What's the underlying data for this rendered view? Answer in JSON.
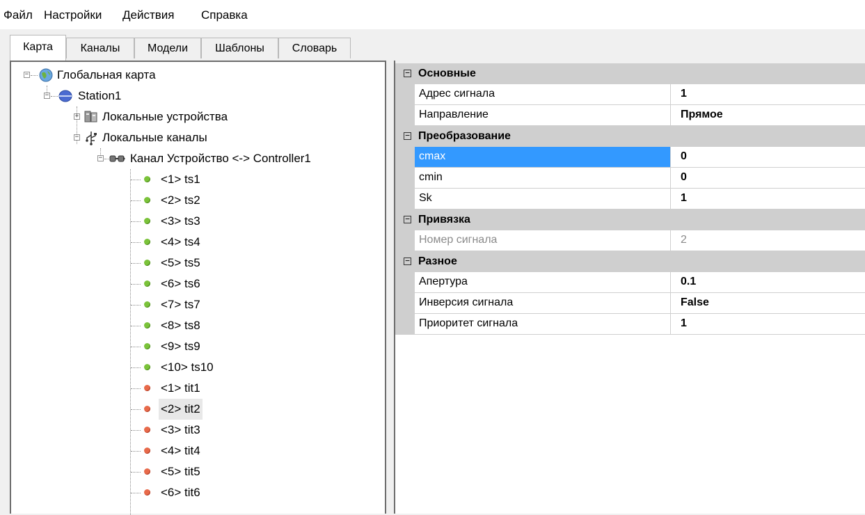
{
  "menu": {
    "file": "Файл",
    "settings": "Настройки",
    "actions": "Действия",
    "help": "Справка"
  },
  "tabs": [
    "Карта",
    "Каналы",
    "Модели",
    "Шаблоны",
    "Словарь"
  ],
  "tree": {
    "root": "Глобальная карта",
    "station": "Station1",
    "local_devices": "Локальные устройства",
    "local_channels": "Локальные каналы",
    "channel": "Канал Устройство <-> Controller1",
    "signals": [
      {
        "label": "<1> ts1",
        "status": "green"
      },
      {
        "label": "<2> ts2",
        "status": "green"
      },
      {
        "label": "<3> ts3",
        "status": "green"
      },
      {
        "label": "<4> ts4",
        "status": "green"
      },
      {
        "label": "<5> ts5",
        "status": "green"
      },
      {
        "label": "<6> ts6",
        "status": "green"
      },
      {
        "label": "<7> ts7",
        "status": "green"
      },
      {
        "label": "<8> ts8",
        "status": "green"
      },
      {
        "label": "<9> ts9",
        "status": "green"
      },
      {
        "label": "<10> ts10",
        "status": "green"
      },
      {
        "label": "<1> tit1",
        "status": "red"
      },
      {
        "label": "<2> tit2",
        "status": "red"
      },
      {
        "label": "<3> tit3",
        "status": "red"
      },
      {
        "label": "<4> tit4",
        "status": "red"
      },
      {
        "label": "<5> tit5",
        "status": "red"
      },
      {
        "label": "<6> tit6",
        "status": "red"
      }
    ],
    "selected_signal": "<2> tit2"
  },
  "properties": {
    "main": {
      "title": "Основные",
      "address_label": "Адрес сигнала",
      "address_value": "1",
      "direction_label": "Направление",
      "direction_value": "Прямое"
    },
    "conversion": {
      "title": "Преобразование",
      "cmax_label": "cmax",
      "cmax_value": "0",
      "cmin_label": "cmin",
      "cmin_value": "0",
      "sk_label": "Sk",
      "sk_value": "1"
    },
    "binding": {
      "title": "Привязка",
      "number_label": "Номер сигнала",
      "number_value": "2"
    },
    "misc": {
      "title": "Разное",
      "aperture_label": "Апертура",
      "aperture_value": "0.1",
      "inversion_label": "Инверсия сигнала",
      "inversion_value": "False",
      "priority_label": "Приоритет сигнала",
      "priority_value": "1"
    }
  },
  "colors": {
    "selection": "#3399ff",
    "category_bg": "#cfcfcf",
    "status_green": "#7bc33a",
    "status_red": "#e86a4a"
  }
}
